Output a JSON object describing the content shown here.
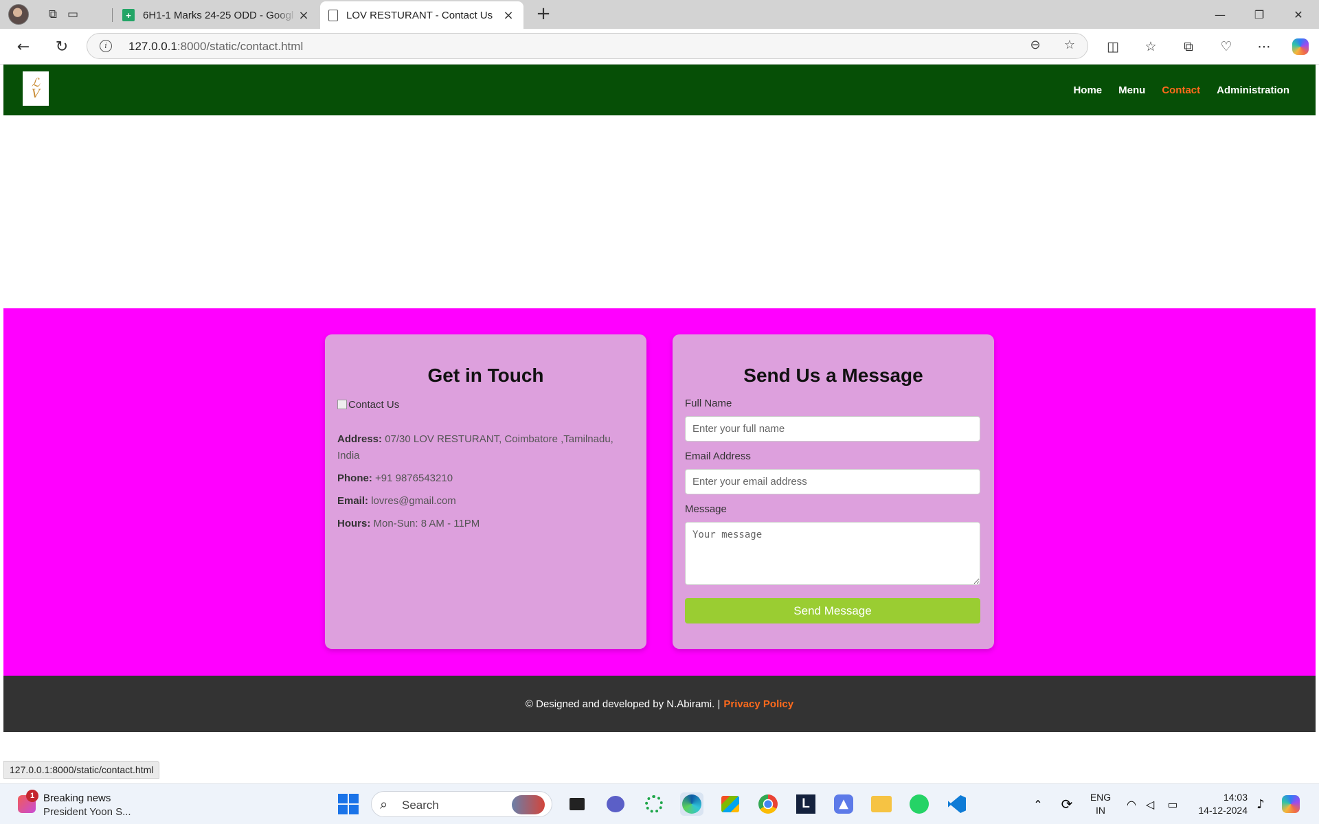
{
  "browser": {
    "tabs": [
      {
        "title": "6H1-1 Marks 24-25 ODD - Googl",
        "favicon": "sheets-icon",
        "active": false
      },
      {
        "title": "LOV RESTURANT - Contact Us",
        "favicon": "page-icon",
        "active": true
      }
    ],
    "url_host": "127.0.0.1",
    "url_rest": ":8000/static/contact.html",
    "status_url": "127.0.0.1:8000/static/contact.html"
  },
  "site": {
    "nav": {
      "items": [
        {
          "label": "Home",
          "active": false
        },
        {
          "label": "Menu",
          "active": false
        },
        {
          "label": "Contact",
          "active": true
        },
        {
          "label": "Administration",
          "active": false
        }
      ],
      "bg_color": "#064f06",
      "active_color": "#ff6a1c"
    },
    "contact": {
      "bg_color": "#ff00ff",
      "card_color": "#dda0dd",
      "left": {
        "title": "Get in Touch",
        "image_alt": "Contact Us",
        "address_label": "Address:",
        "address": "07/30 LOV RESTURANT, Coimbatore ,Tamilnadu, India",
        "phone_label": "Phone:",
        "phone": "+91 9876543210",
        "email_label": "Email:",
        "email": "lovres@gmail.com",
        "hours_label": "Hours:",
        "hours": "Mon-Sun: 8 AM - 11PM"
      },
      "right": {
        "title": "Send Us a Message",
        "name_label": "Full Name",
        "name_placeholder": "Enter your full name",
        "email_label": "Email Address",
        "email_placeholder": "Enter your email address",
        "message_label": "Message",
        "message_placeholder": "Your message",
        "submit_label": "Send Message",
        "submit_color": "#9acd32"
      }
    },
    "footer": {
      "text": "© Designed and developed by N.Abirami. |",
      "privacy_label": "Privacy Policy"
    }
  },
  "taskbar": {
    "news_badge": "1",
    "news_title": "Breaking news",
    "news_subtitle": "President Yoon S...",
    "search_label": "Search",
    "lang_line1": "ENG",
    "lang_line2": "IN",
    "time": "14:03",
    "date": "14-12-2024"
  }
}
